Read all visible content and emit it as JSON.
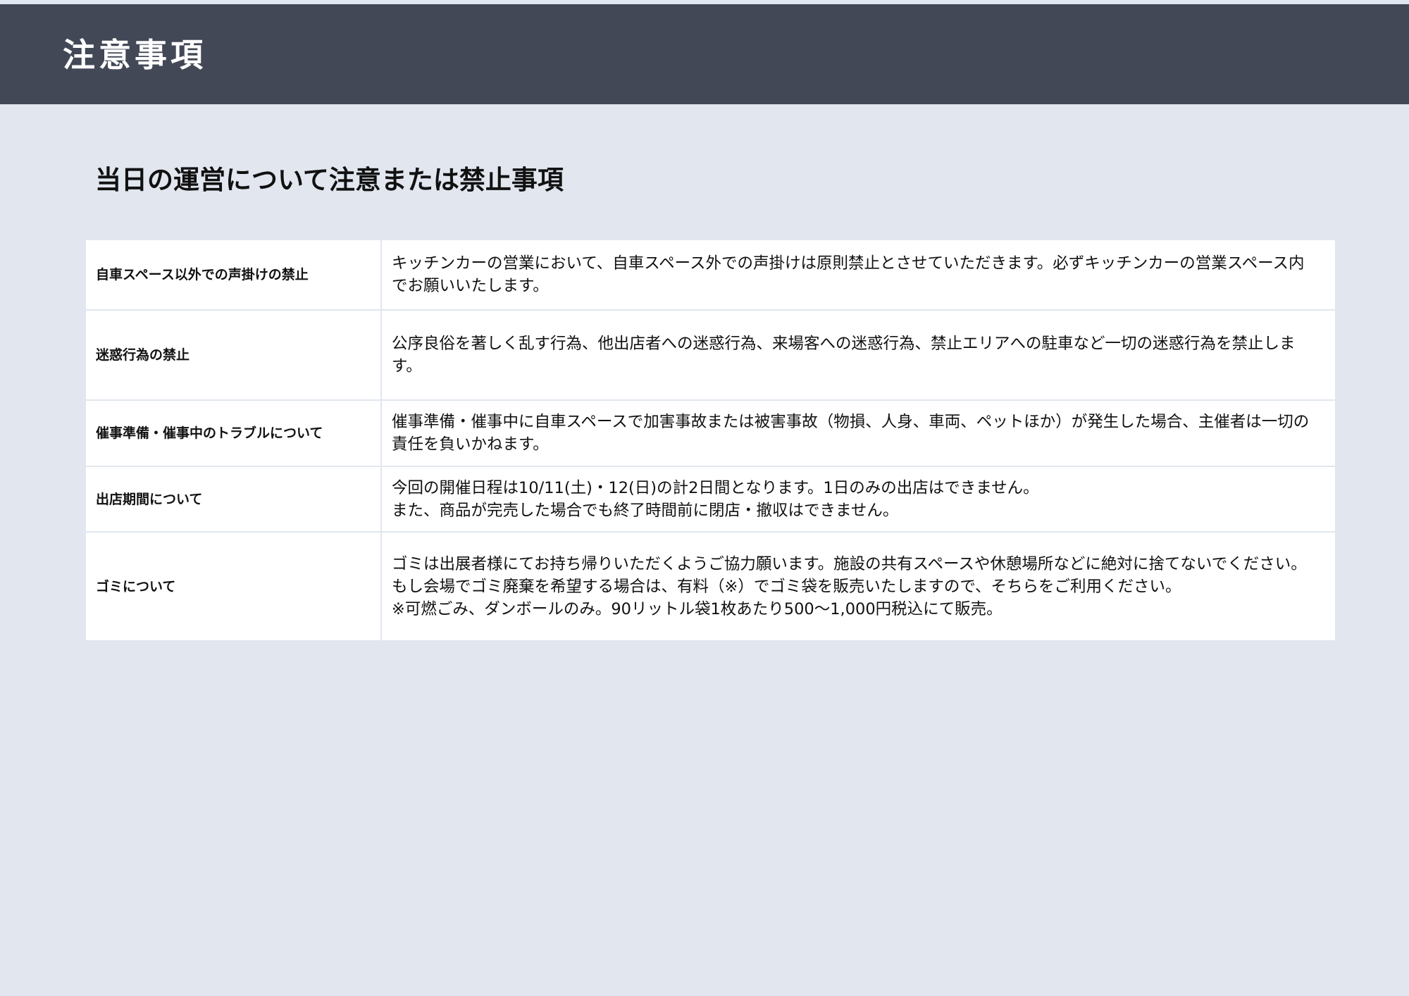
{
  "header": {
    "title": "注意事項"
  },
  "section": {
    "title": "当日の運営について注意または禁止事項"
  },
  "rows": [
    {
      "label": "自車スペース以外での声掛けの禁止",
      "lines": [
        "キッチンカーの営業において、自車スペース外での声掛けは原則禁止とさせていただきます。必ずキッチンカーの営業スペース内でお願いいたします。"
      ]
    },
    {
      "label": "迷惑行為の禁止",
      "lines": [
        "公序良俗を著しく乱す行為、他出店者への迷惑行為、来場客への迷惑行為、禁止エリアへの駐車など一切の迷惑行為を禁止します。"
      ]
    },
    {
      "label": "催事準備・催事中のトラブルについて",
      "lines": [
        "催事準備・催事中に自車スペースで加害事故または被害事故（物損、人身、車両、ペットほか）が発生した場合、主催者は一切の責任を負いかねます。"
      ]
    },
    {
      "label": "出店期間について",
      "lines": [
        "今回の開催日程は10/11(土)・12(日)の計2日間となります。1日のみの出店はできません。",
        "また、商品が完売した場合でも終了時間前に閉店・撤収はできません。"
      ]
    },
    {
      "label": "ゴミについて",
      "lines": [
        "ゴミは出展者様にてお持ち帰りいただくようご協力願います。施設の共有スペースや休憩場所などに絶対に捨てないでください。",
        "もし会場でゴミ廃棄を希望する場合は、有料（※）でゴミ袋を販売いたしますので、そちらをご利用ください。",
        "※可燃ごみ、ダンボールのみ。90リットル袋1枚あたり500〜1,000円税込にて販売。"
      ]
    }
  ]
}
